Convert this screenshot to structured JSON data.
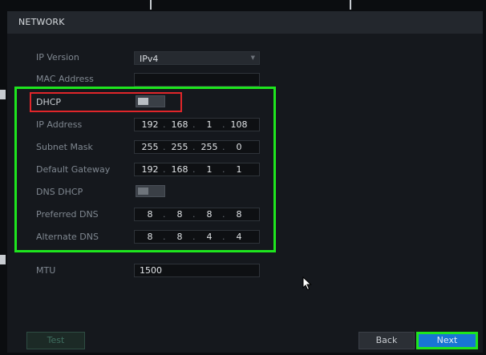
{
  "window": {
    "title": "NETWORK"
  },
  "colors": {
    "accent": "#1876d4",
    "highlight_green": "#1ee51e",
    "highlight_red": "#e0262a"
  },
  "fields": {
    "ip_version": {
      "label": "IP Version",
      "value": "IPv4"
    },
    "mac_address": {
      "label": "MAC Address",
      "value": ""
    },
    "dhcp": {
      "label": "DHCP",
      "enabled": false
    },
    "ip_address": {
      "label": "IP Address",
      "octets": [
        "192",
        "168",
        "1",
        "108"
      ]
    },
    "subnet_mask": {
      "label": "Subnet Mask",
      "octets": [
        "255",
        "255",
        "255",
        "0"
      ]
    },
    "default_gateway": {
      "label": "Default Gateway",
      "octets": [
        "192",
        "168",
        "1",
        "1"
      ]
    },
    "dns_dhcp": {
      "label": "DNS DHCP",
      "enabled": false
    },
    "preferred_dns": {
      "label": "Preferred DNS",
      "octets": [
        "8",
        "8",
        "8",
        "8"
      ]
    },
    "alternate_dns": {
      "label": "Alternate DNS",
      "octets": [
        "8",
        "8",
        "4",
        "4"
      ]
    },
    "mtu": {
      "label": "MTU",
      "value": "1500"
    }
  },
  "buttons": {
    "test": "Test",
    "back": "Back",
    "next": "Next"
  },
  "icons": {
    "dropdown": "chevron-down-icon",
    "pointer": "mouse-pointer-icon"
  }
}
